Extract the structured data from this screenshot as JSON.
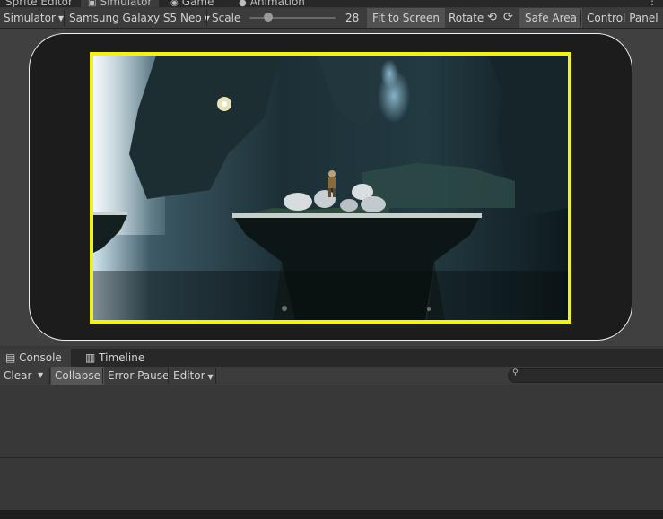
{
  "top_tabs": [
    {
      "label": "Sprite Editor",
      "icon": "none"
    },
    {
      "label": "Simulator",
      "icon": "simulator-icon",
      "active": true
    },
    {
      "label": "Game",
      "icon": "gamepad-icon"
    },
    {
      "label": "Animation",
      "icon": "animation-icon"
    }
  ],
  "toolbar": {
    "mode": "Simulator",
    "device": "Samsung Galaxy S5 Neo",
    "scale_label": "Scale",
    "scale_value": "28",
    "fit_to_screen": "Fit to Screen",
    "rotate": "Rotate",
    "safe_area": "Safe Area",
    "control_panel": "Control Panel"
  },
  "console": {
    "tabs": [
      {
        "label": "Console",
        "icon": "console-icon",
        "active": true
      },
      {
        "label": "Timeline",
        "icon": "timeline-icon"
      }
    ],
    "clear": "Clear",
    "collapse": "Collapse",
    "error_pause": "Error Pause",
    "editor": "Editor",
    "search_placeholder": ""
  },
  "colors": {
    "safe_area_outline": "#f4f40a",
    "device_bezel": "#f0f0f0",
    "editor_bg": "#383838"
  }
}
